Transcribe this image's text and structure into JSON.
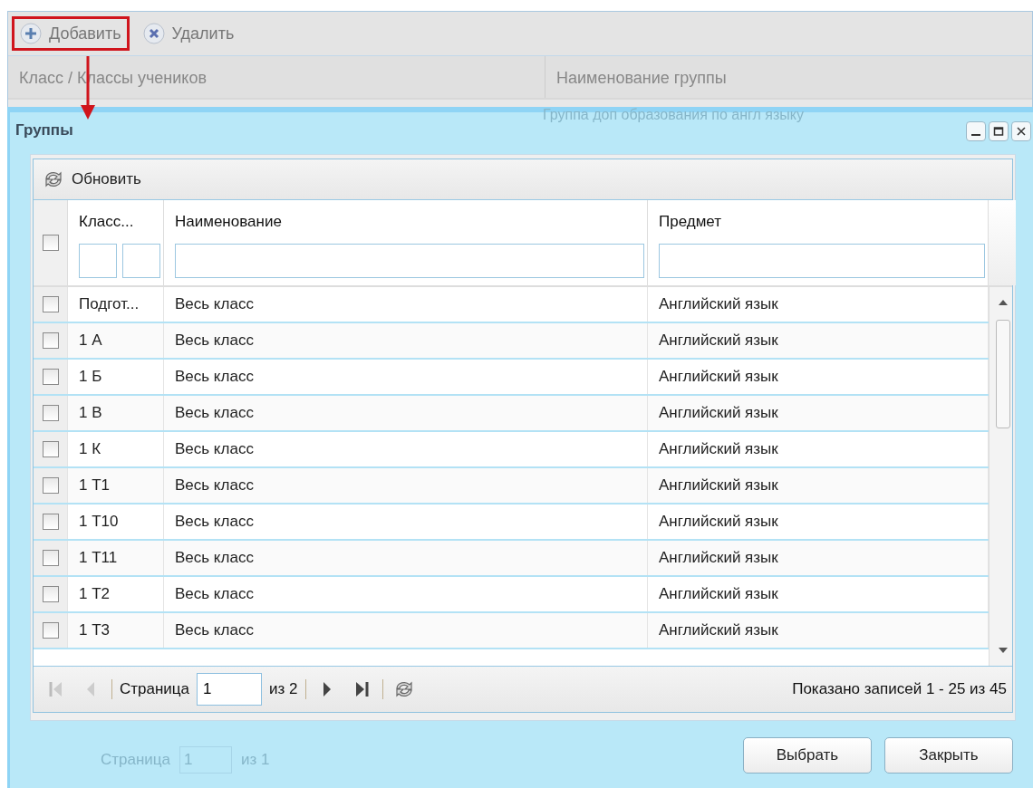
{
  "toolbar": {
    "buttons": [
      {
        "kind": "add",
        "label": "Добавить",
        "highlighted": true
      },
      {
        "kind": "delete",
        "label": "Удалить",
        "highlighted": false
      }
    ]
  },
  "background_table": {
    "columns": [
      "Класс / Классы учеников",
      "Наименование группы"
    ],
    "row_text": "Группа доп образования по англ языку"
  },
  "background_pager": {
    "page_label": "Страница",
    "page_value": "1",
    "of_total": "из 1"
  },
  "dialog": {
    "title": "Группы",
    "toolbar": {
      "refresh_label": "Обновить"
    },
    "table": {
      "all_checked": false,
      "columns": [
        "Класс...",
        "Наименование",
        "Предмет"
      ],
      "rows": [
        {
          "class": "Подгот...",
          "name": "Весь класс",
          "subject": "Английский язык",
          "checked": false
        },
        {
          "class": "1 А",
          "name": "Весь класс",
          "subject": "Английский язык",
          "checked": false
        },
        {
          "class": "1 Б",
          "name": "Весь класс",
          "subject": "Английский язык",
          "checked": false
        },
        {
          "class": "1 В",
          "name": "Весь класс",
          "subject": "Английский язык",
          "checked": false
        },
        {
          "class": "1 К",
          "name": "Весь класс",
          "subject": "Английский язык",
          "checked": false
        },
        {
          "class": "1 Т1",
          "name": "Весь класс",
          "subject": "Английский язык",
          "checked": false
        },
        {
          "class": "1 Т10",
          "name": "Весь класс",
          "subject": "Английский язык",
          "checked": false
        },
        {
          "class": "1 Т11",
          "name": "Весь класс",
          "subject": "Английский язык",
          "checked": false
        },
        {
          "class": "1 Т2",
          "name": "Весь класс",
          "subject": "Английский язык",
          "checked": false
        },
        {
          "class": "1 Т3",
          "name": "Весь класс",
          "subject": "Английский язык",
          "checked": false
        }
      ]
    },
    "pager": {
      "page_label": "Страница",
      "page_value": "1",
      "of_total": "из 2",
      "summary": "Показано записей 1 - 25 из 45"
    },
    "buttons": [
      "Выбрать",
      "Закрыть"
    ]
  }
}
